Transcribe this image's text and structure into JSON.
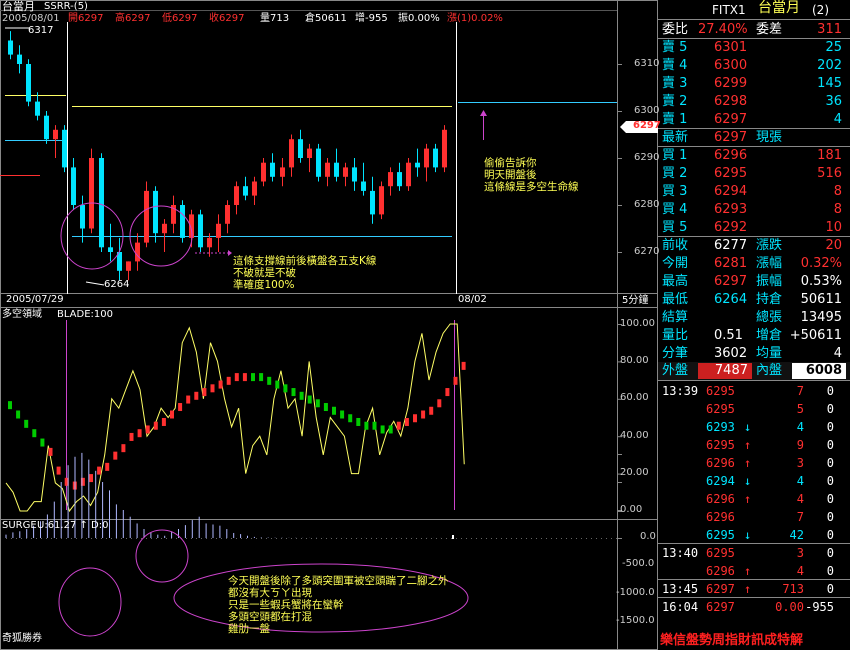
{
  "colors": {
    "up": "#ff3030",
    "down": "#00e5ff",
    "flat": "#ffffff",
    "annotation": "#ffff55",
    "circle": "#cc44cc",
    "line": "#ffff66",
    "grid": "#666666"
  },
  "main": {
    "title": "台當月",
    "indicator": "SSRR-(5)",
    "quote": {
      "date": "2005/08/01",
      "open": "開6297",
      "high": "高6297",
      "low": "低6297",
      "close": "收6297",
      "volume": "量713",
      "oi": "倉50611",
      "chg": "增-955",
      "amp": "振0.00%",
      "rise": "漲(1)0.02%"
    },
    "y_ticks": [
      "6310",
      "6300",
      "6290",
      "6280",
      "6270"
    ],
    "price_tag": "6297",
    "label_high": "6317",
    "label_low": "6264",
    "date_left": "2005/07/29",
    "date_right": "08/02",
    "interval": "5分鐘",
    "note_right": [
      "偷偷告訴你",
      "明天開盤後",
      "這條線是多空生命線"
    ],
    "note_support": [
      "這條支撐線前後橫盤各五支K線",
      "不破就是不破",
      "準確度100%"
    ]
  },
  "blade": {
    "title": "多空領域",
    "param": "BLADE:100",
    "y_ticks": [
      "100.00",
      "80.00",
      "60.00",
      "40.00",
      "20.00",
      "0.00"
    ]
  },
  "surge": {
    "title": "SURGE",
    "values": "U:61.27 ↑ D:0",
    "y_ticks": [
      "0.0",
      "-500.0",
      "-1000.0",
      "-1500.0"
    ],
    "note": [
      "今天開盤後除了多頭突圍軍被空頭踹了二腳之外",
      "都沒有大ㄎㄚ出現",
      "只是一些蝦兵蟹將在蠻幹",
      "多頭空頭都在打混",
      "雞肋一盤"
    ]
  },
  "footer": {
    "left": "奇狐勝券"
  },
  "right_panel": {
    "symbol": "FITX1",
    "name": "台當月",
    "name_suffix": "(2)",
    "ratio_label": "委比",
    "ratio_value": "27.40%",
    "diff_label": "委差",
    "diff_value": "311",
    "asks": [
      {
        "label": "賣 5",
        "price": "6301",
        "vol": "25"
      },
      {
        "label": "賣 4",
        "price": "6300",
        "vol": "202"
      },
      {
        "label": "賣 3",
        "price": "6299",
        "vol": "145"
      },
      {
        "label": "賣 2",
        "price": "6298",
        "vol": "36"
      },
      {
        "label": "賣 1",
        "price": "6297",
        "vol": "4"
      }
    ],
    "last": {
      "label": "最新",
      "price": "6297",
      "side": "現張"
    },
    "bids": [
      {
        "label": "買 1",
        "price": "6296",
        "vol": "181"
      },
      {
        "label": "買 2",
        "price": "6295",
        "vol": "516"
      },
      {
        "label": "買 3",
        "price": "6294",
        "vol": "8"
      },
      {
        "label": "買 4",
        "price": "6293",
        "vol": "8"
      },
      {
        "label": "買 5",
        "price": "6292",
        "vol": "10"
      }
    ],
    "stats": [
      {
        "l1": "前收",
        "v1": "6277",
        "l2": "漲跌",
        "v2": "20",
        "c1": "#ffffff",
        "c2": "#ff3030"
      },
      {
        "l1": "今開",
        "v1": "6281",
        "l2": "漲幅",
        "v2": "0.32%",
        "c1": "#ff3030",
        "c2": "#ff3030"
      },
      {
        "l1": "最高",
        "v1": "6297",
        "l2": "振幅",
        "v2": "0.53%",
        "c1": "#ff3030",
        "c2": "#ffffff"
      },
      {
        "l1": "最低",
        "v1": "6264",
        "l2": "持倉",
        "v2": "50611",
        "c1": "#00e5ff",
        "c2": "#ffffff"
      },
      {
        "l1": "結算",
        "v1": "",
        "l2": "總張",
        "v2": "13495",
        "c1": "#ffffff",
        "c2": "#ffffff"
      },
      {
        "l1": "量比",
        "v1": "0.51",
        "l2": "增倉",
        "v2": "+50611",
        "c1": "#ffffff",
        "c2": "#ffffff"
      },
      {
        "l1": "分筆",
        "v1": "3602",
        "l2": "均量",
        "v2": "4",
        "c1": "#ffffff",
        "c2": "#ffffff"
      }
    ],
    "outer_label": "外盤",
    "outer_value": "7487",
    "inner_label": "內盤",
    "inner_value": "6008",
    "ticks": [
      {
        "time": "13:39",
        "price": "6295",
        "arrow": "",
        "vol": "7",
        "chg": "0",
        "c": "#ff3030"
      },
      {
        "time": "",
        "price": "6295",
        "arrow": "",
        "vol": "5",
        "chg": "0",
        "c": "#ff3030"
      },
      {
        "time": "",
        "price": "6293",
        "arrow": "↓",
        "vol": "4",
        "chg": "0",
        "c": "#00e5ff"
      },
      {
        "time": "",
        "price": "6295",
        "arrow": "↑",
        "vol": "9",
        "chg": "0",
        "c": "#ff3030"
      },
      {
        "time": "",
        "price": "6296",
        "arrow": "↑",
        "vol": "3",
        "chg": "0",
        "c": "#ff3030"
      },
      {
        "time": "",
        "price": "6294",
        "arrow": "↓",
        "vol": "4",
        "chg": "0",
        "c": "#00e5ff"
      },
      {
        "time": "",
        "price": "6296",
        "arrow": "↑",
        "vol": "4",
        "chg": "0",
        "c": "#ff3030"
      },
      {
        "time": "",
        "price": "6296",
        "arrow": "",
        "vol": "7",
        "chg": "0",
        "c": "#ff3030"
      },
      {
        "time": "",
        "price": "6295",
        "arrow": "↓",
        "vol": "42",
        "chg": "0",
        "c": "#00e5ff"
      },
      {
        "time": "13:40",
        "price": "6295",
        "arrow": "",
        "vol": "3",
        "chg": "0",
        "c": "#ff3030"
      },
      {
        "time": "",
        "price": "6296",
        "arrow": "↑",
        "vol": "4",
        "chg": "0",
        "c": "#ff3030"
      },
      {
        "time": "13:45",
        "price": "6297",
        "arrow": "↑",
        "vol": "713",
        "chg": "0",
        "c": "#ff3030"
      },
      {
        "time": "16:04",
        "price": "6297",
        "arrow": "",
        "vol": "0.00",
        "chg": "-955",
        "c": "#ff3030"
      }
    ],
    "banner": "樂信盤勢周指財訊成特解"
  }
}
